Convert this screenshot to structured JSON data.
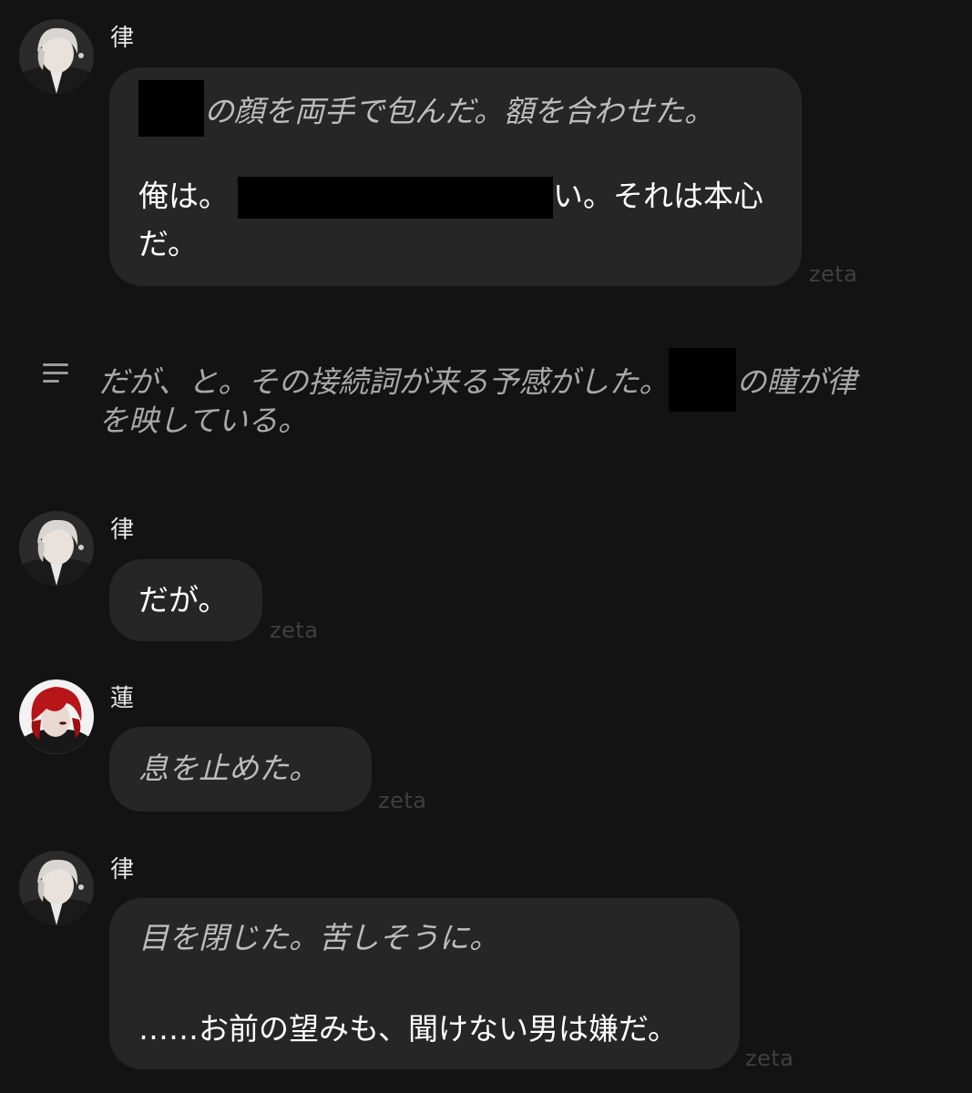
{
  "watermark": "zeta",
  "messages": [
    {
      "speaker": "律",
      "lines": [
        {
          "before": "",
          "after": "の顔を両手で包んだ。額を合わせた。"
        },
        {
          "before": "俺は。",
          "after": "い。それは本心"
        },
        {
          "text": "だ。"
        }
      ]
    },
    {
      "speaker": "律",
      "lines": [
        {
          "text": "だが。"
        }
      ]
    },
    {
      "speaker": "蓮",
      "lines": [
        {
          "text": "息を止めた。"
        }
      ]
    },
    {
      "speaker": "律",
      "lines": [
        {
          "text": "目を閉じた。苦しそうに。"
        },
        {
          "text": "……お前の望みも、聞けない男は嫌だ。"
        }
      ]
    }
  ],
  "narration": {
    "icon": "narration-lines-icon",
    "line1_before": "だが、と。その接続詞が来る予感がした。",
    "line1_after": "の瞳が律",
    "line2": "を映している。"
  },
  "colors": {
    "background": "#131313",
    "bubble": "#262626",
    "narration_text": "#a8a8a8",
    "italic_text": "#bdbdbd"
  }
}
